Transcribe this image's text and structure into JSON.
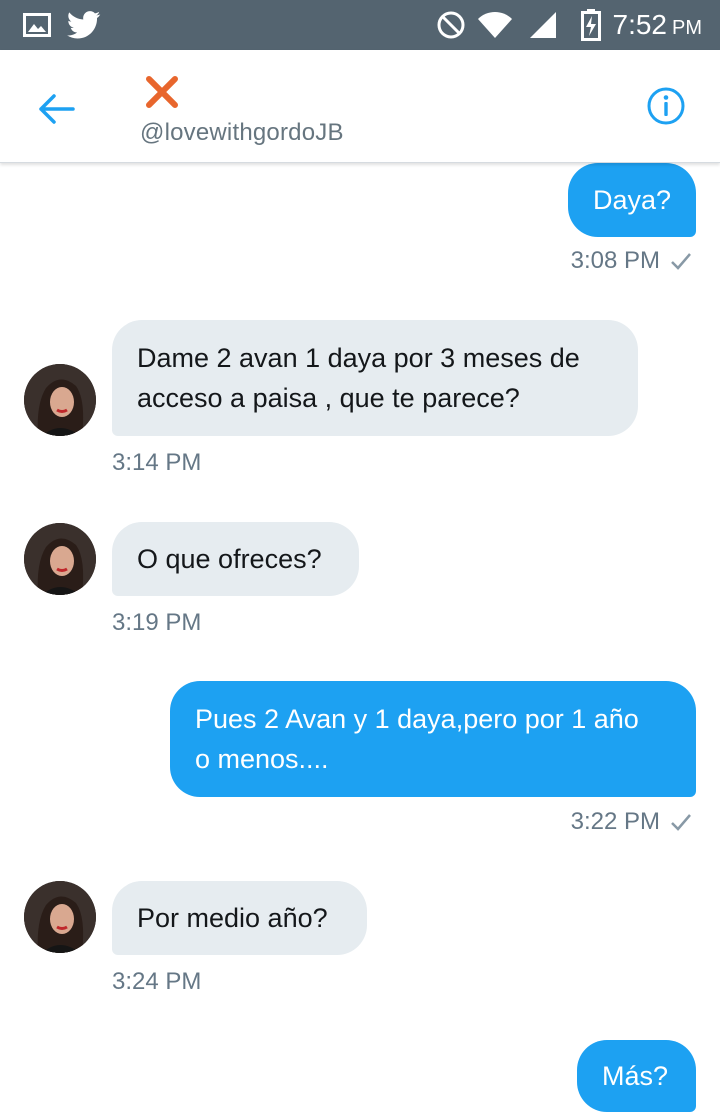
{
  "status_bar": {
    "time": "7:52",
    "ampm": "PM",
    "left_icons": [
      "image-notification-icon",
      "twitter-bird-icon"
    ],
    "right_icons": [
      "do-not-disturb-icon",
      "wifi-icon",
      "cell-signal-icon",
      "battery-charging-icon"
    ]
  },
  "header": {
    "display_name_icon": "cross-mark-icon",
    "handle": "@lovewithgordoJB",
    "back_icon": "back-arrow-icon",
    "info_icon": "info-icon",
    "accent_color": "#1da1f2",
    "name_mark_color": "#e8662d"
  },
  "messages": [
    {
      "direction": "out",
      "lines": [
        "Daya?"
      ],
      "time": "3:08 PM"
    },
    {
      "direction": "in",
      "lines": [
        "Dame 2 avan 1 daya por 3 meses de",
        "acceso a paisa , que te parece?"
      ],
      "time": "3:14 PM"
    },
    {
      "direction": "in",
      "lines": [
        "O que ofreces?"
      ],
      "time": "3:19 PM"
    },
    {
      "direction": "out",
      "lines": [
        "Pues 2 Avan y 1 daya,pero por 1 año",
        "o menos...."
      ],
      "time": "3:22 PM"
    },
    {
      "direction": "in",
      "lines": [
        "Por medio año?"
      ],
      "time": "3:24 PM"
    },
    {
      "direction": "out",
      "lines": [
        "Más?"
      ],
      "time": ""
    }
  ],
  "colors": {
    "outgoing_bubble": "#1da1f2",
    "incoming_bubble": "#e6ecf0",
    "status_bar": "#546470",
    "timestamp": "#657786"
  }
}
